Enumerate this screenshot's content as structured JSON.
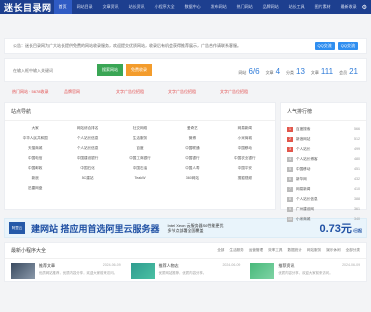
{
  "header": {
    "logo": "迷长目录网",
    "nav": [
      "首页",
      "网站目录",
      "文章资讯",
      "站长资讯",
      "小程序大全",
      "数据中心",
      "发布网站",
      "热门网站",
      "品牌网站",
      "站长工具",
      "图片素材",
      "最新收录"
    ],
    "right": [
      "登录",
      "注册"
    ]
  },
  "notice": {
    "text": "公告：迷长目录网为广大站长提供免费的网站收录服务，欢迎提交优质网站，收录后有机会获得推荐展示，广告合作请联系客服。",
    "qq1": "QQ交流",
    "qq2": "QQ交流"
  },
  "search": {
    "placeholder": "在输入框中输入关键词",
    "btn_search": "搜索网站",
    "btn_submit": "免费收录",
    "stats": [
      {
        "label": "网站",
        "value": "6/6"
      },
      {
        "label": "文章",
        "value": "4"
      },
      {
        "label": "分类",
        "value": "13"
      },
      {
        "label": "文章",
        "value": "111"
      },
      {
        "label": "会员",
        "value": "21"
      }
    ]
  },
  "quick_links": [
    "热门网站 · 5678收录",
    "品牌官网",
    "文字广告位招租",
    "文字广告位招租",
    "文字广告位招租"
  ],
  "categories": {
    "title": "站点导航",
    "items": [
      "大家",
      "网站综合排名",
      "社交网络",
      "爱奇艺",
      "网易新闻",
      "中华人民共和国",
      "个人站长信息",
      "生活服务",
      "微博",
      "小米商城",
      "天猫商城",
      "个人站长信息",
      "百度",
      "中国联通",
      "中国移动",
      "中国电信",
      "中国建设银行",
      "中国工商银行",
      "中国银行",
      "中国农业银行",
      "中国邮政",
      "中国石化",
      "中国石油",
      "中国人寿",
      "中国平安",
      "新浪",
      "5C建站",
      "TeakW",
      "360网站",
      "搜狐视频",
      "迅雷网盘",
      "",
      "",
      "",
      ""
    ]
  },
  "ranking": {
    "title": "人气排行榜",
    "items": [
      {
        "name": "百度搜索",
        "count": "566"
      },
      {
        "name": "新浪网站",
        "count": "512"
      },
      {
        "name": "个人站长",
        "count": "499"
      },
      {
        "name": "个人站长博客",
        "count": "480"
      },
      {
        "name": "中国移动",
        "count": "451"
      },
      {
        "name": "新华网",
        "count": "432"
      },
      {
        "name": "网易新闻",
        "count": "410"
      },
      {
        "name": "个人站长信息",
        "count": "388"
      },
      {
        "name": "广州建设网",
        "count": "361"
      },
      {
        "name": "小米商城",
        "count": "340"
      }
    ]
  },
  "banner": {
    "logo": "阿里云",
    "headline": "建网站 搭应用首选阿里云服务器",
    "sub1": "Intel Xeon 云服务器S6性能更优",
    "sub2": "多节点部署全国覆盖",
    "price": "0.73元",
    "unit": "/日起"
  },
  "recent": {
    "title": "最新小程序大全",
    "tags": [
      "全部",
      "生活服务",
      "运营管理",
      "效率工具",
      "数据统计",
      "网站服务",
      "娱乐休闲",
      "全部分类"
    ],
    "cards": [
      {
        "title": "推荐文章",
        "date": "2024-06-09",
        "desc": "优质网站推荐，优质内容分享，欢迎大家前来访问。"
      },
      {
        "title": "推荐人物志",
        "date": "2024-06-09",
        "desc": "优质网站推荐，优质内容分享。"
      },
      {
        "title": "推荐资讯",
        "date": "2024-06-09",
        "desc": "优质内容分享，欢迎大家前来访问。"
      }
    ]
  }
}
